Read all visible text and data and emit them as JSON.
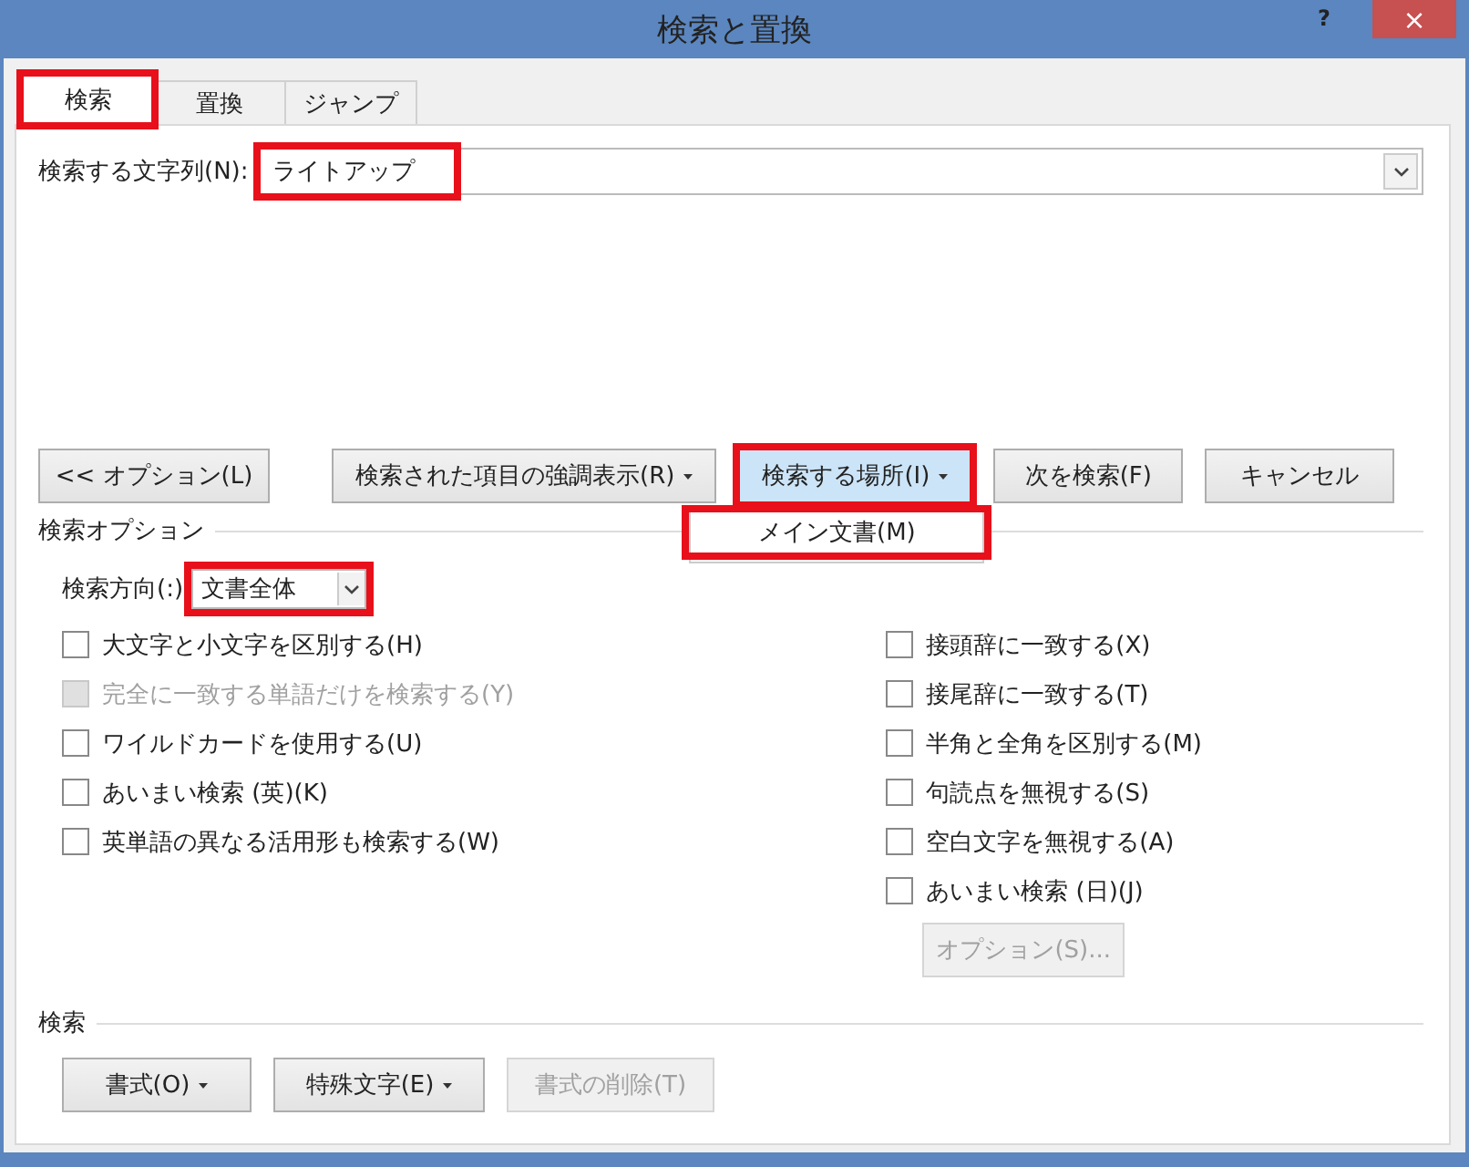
{
  "window": {
    "title": "検索と置換",
    "help": "?",
    "close": "×"
  },
  "tabs": [
    {
      "label": "検索",
      "selected": true,
      "highlighted": true
    },
    {
      "label": "置換",
      "selected": false,
      "highlighted": false
    },
    {
      "label": "ジャンプ",
      "selected": false,
      "highlighted": false
    }
  ],
  "find": {
    "label": "検索する文字列(N):",
    "value": "ライトアップ",
    "highlighted": true
  },
  "buttons": [
    {
      "label": "<< オプション(L)",
      "caret": false,
      "selected": false,
      "highlighted": false
    },
    {
      "label": "検索された項目の強調表示(R)",
      "caret": true,
      "selected": false,
      "highlighted": false
    },
    {
      "label": "検索する場所(I)",
      "caret": true,
      "selected": true,
      "highlighted": true
    },
    {
      "label": "次を検索(F)",
      "caret": false,
      "selected": false,
      "highlighted": false
    },
    {
      "label": "キャンセル",
      "caret": false,
      "selected": false,
      "highlighted": false
    }
  ],
  "menu": {
    "items": [
      {
        "label": "メイン文書(M)",
        "highlighted": true
      }
    ]
  },
  "options": {
    "title": "検索オプション",
    "direction": {
      "label": "検索方向(:)",
      "value": "文書全体",
      "highlighted": true
    },
    "left": [
      {
        "label": "大文字と小文字を区別する(H)",
        "checked": false,
        "disabled": false
      },
      {
        "label": "完全に一致する単語だけを検索する(Y)",
        "checked": false,
        "disabled": true
      },
      {
        "label": "ワイルドカードを使用する(U)",
        "checked": false,
        "disabled": false
      },
      {
        "label": "あいまい検索 (英)(K)",
        "checked": false,
        "disabled": false
      },
      {
        "label": "英単語の異なる活用形も検索する(W)",
        "checked": false,
        "disabled": false
      }
    ],
    "right": [
      {
        "label": "接頭辞に一致する(X)",
        "checked": false,
        "disabled": false
      },
      {
        "label": "接尾辞に一致する(T)",
        "checked": false,
        "disabled": false
      },
      {
        "label": "半角と全角を区別する(M)",
        "checked": false,
        "disabled": false
      },
      {
        "label": "句読点を無視する(S)",
        "checked": false,
        "disabled": false
      },
      {
        "label": "空白文字を無視する(A)",
        "checked": false,
        "disabled": false
      },
      {
        "label": "あいまい検索 (日)(J)",
        "checked": false,
        "disabled": false
      }
    ],
    "sub_button": {
      "label": "オプション(S)...",
      "disabled": true
    }
  },
  "format_group": {
    "title": "検索",
    "buttons": [
      {
        "label": "書式(O)",
        "caret": true,
        "disabled": false
      },
      {
        "label": "特殊文字(E)",
        "caret": true,
        "disabled": false
      },
      {
        "label": "書式の削除(T)",
        "caret": false,
        "disabled": true
      }
    ]
  }
}
